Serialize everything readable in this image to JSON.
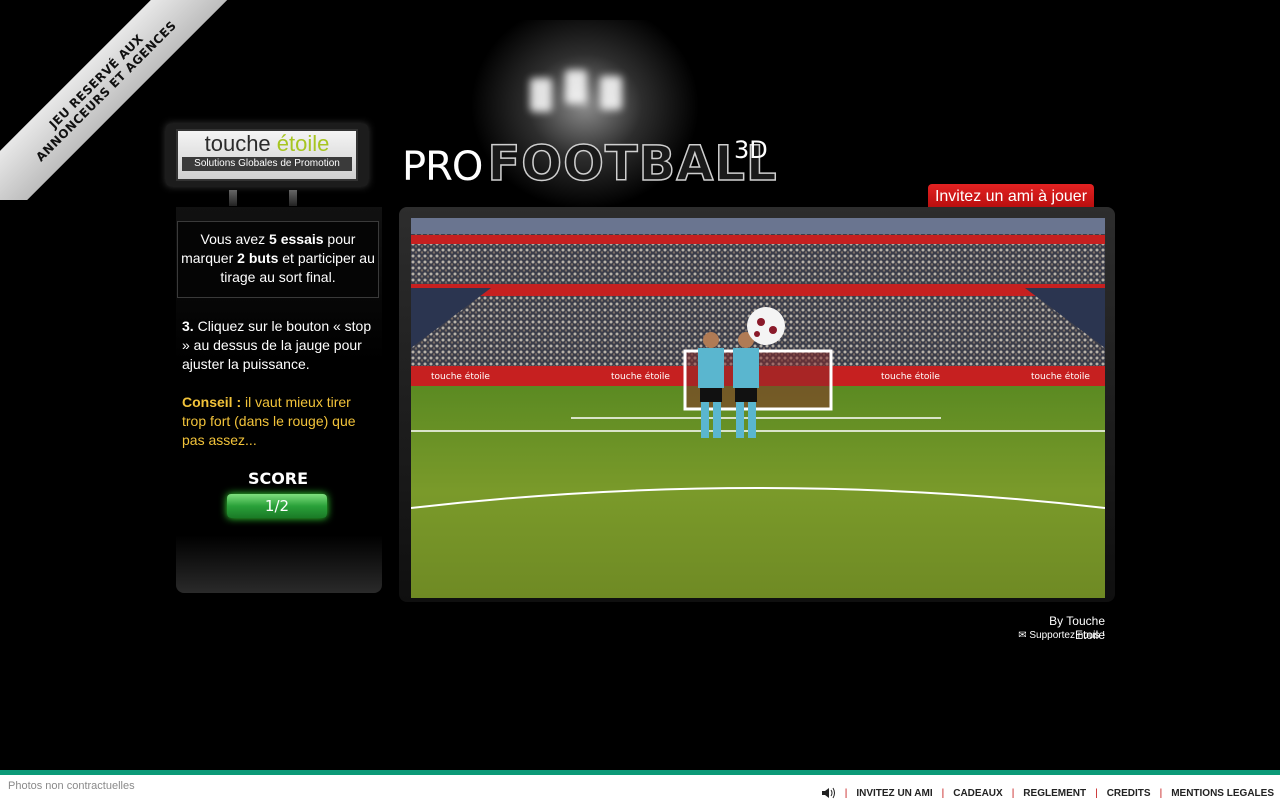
{
  "ribbon": {
    "line1": "JEU RESERVÉ AUX",
    "line2": "ANNONCEURS ET AGENCES"
  },
  "logo": {
    "brand_a": "touche ",
    "brand_b": "étoile",
    "tagline": "Solutions Globales de Promotion"
  },
  "title": {
    "pro": "PRO",
    "football": "FOOTBALL",
    "suffix": "3D"
  },
  "invite_button": "Invitez un ami à jouer",
  "panel": {
    "info": {
      "t1": "Vous avez ",
      "b1": "5 essais",
      "t2": " pour marquer ",
      "b2": "2 buts",
      "t3": " et participer au tirage au sort final."
    },
    "step_number": "3.",
    "step_text": " Cliquez sur le bouton « stop » au dessus de la jauge pour ajuster la puissance.",
    "tip_label": "Conseil :",
    "tip_text": " il vaut mieux tirer trop fort (dans le rouge) que pas assez...",
    "score_label": "SCORE",
    "score_value": "1/2"
  },
  "game": {
    "banner_text": "touche étoile"
  },
  "byline": "By Touche Etoile",
  "support": "Supportez nous !",
  "footer": {
    "disclaimer": "Photos non contractuelles",
    "links": [
      "INVITEZ UN AMI",
      "CADEAUX",
      "REGLEMENT",
      "CREDITS",
      "MENTIONS LEGALES"
    ]
  },
  "colors": {
    "accent_red": "#c31212",
    "tip_yellow": "#f2c33a",
    "score_green": "#2aa13a",
    "footer_teal": "#0c9a78",
    "logo_green": "#a7c520"
  }
}
